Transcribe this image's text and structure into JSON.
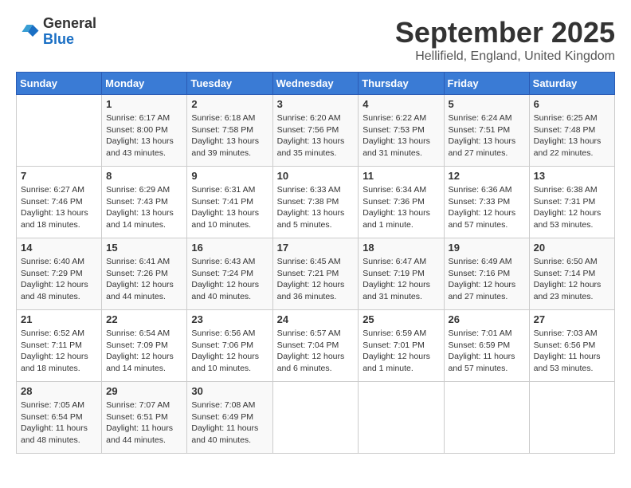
{
  "header": {
    "logo_line1": "General",
    "logo_line2": "Blue",
    "title": "September 2025",
    "subtitle": "Hellifield, England, United Kingdom"
  },
  "weekdays": [
    "Sunday",
    "Monday",
    "Tuesday",
    "Wednesday",
    "Thursday",
    "Friday",
    "Saturday"
  ],
  "weeks": [
    [
      {
        "day": "",
        "info": ""
      },
      {
        "day": "1",
        "info": "Sunrise: 6:17 AM\nSunset: 8:00 PM\nDaylight: 13 hours\nand 43 minutes."
      },
      {
        "day": "2",
        "info": "Sunrise: 6:18 AM\nSunset: 7:58 PM\nDaylight: 13 hours\nand 39 minutes."
      },
      {
        "day": "3",
        "info": "Sunrise: 6:20 AM\nSunset: 7:56 PM\nDaylight: 13 hours\nand 35 minutes."
      },
      {
        "day": "4",
        "info": "Sunrise: 6:22 AM\nSunset: 7:53 PM\nDaylight: 13 hours\nand 31 minutes."
      },
      {
        "day": "5",
        "info": "Sunrise: 6:24 AM\nSunset: 7:51 PM\nDaylight: 13 hours\nand 27 minutes."
      },
      {
        "day": "6",
        "info": "Sunrise: 6:25 AM\nSunset: 7:48 PM\nDaylight: 13 hours\nand 22 minutes."
      }
    ],
    [
      {
        "day": "7",
        "info": "Sunrise: 6:27 AM\nSunset: 7:46 PM\nDaylight: 13 hours\nand 18 minutes."
      },
      {
        "day": "8",
        "info": "Sunrise: 6:29 AM\nSunset: 7:43 PM\nDaylight: 13 hours\nand 14 minutes."
      },
      {
        "day": "9",
        "info": "Sunrise: 6:31 AM\nSunset: 7:41 PM\nDaylight: 13 hours\nand 10 minutes."
      },
      {
        "day": "10",
        "info": "Sunrise: 6:33 AM\nSunset: 7:38 PM\nDaylight: 13 hours\nand 5 minutes."
      },
      {
        "day": "11",
        "info": "Sunrise: 6:34 AM\nSunset: 7:36 PM\nDaylight: 13 hours\nand 1 minute."
      },
      {
        "day": "12",
        "info": "Sunrise: 6:36 AM\nSunset: 7:33 PM\nDaylight: 12 hours\nand 57 minutes."
      },
      {
        "day": "13",
        "info": "Sunrise: 6:38 AM\nSunset: 7:31 PM\nDaylight: 12 hours\nand 53 minutes."
      }
    ],
    [
      {
        "day": "14",
        "info": "Sunrise: 6:40 AM\nSunset: 7:29 PM\nDaylight: 12 hours\nand 48 minutes."
      },
      {
        "day": "15",
        "info": "Sunrise: 6:41 AM\nSunset: 7:26 PM\nDaylight: 12 hours\nand 44 minutes."
      },
      {
        "day": "16",
        "info": "Sunrise: 6:43 AM\nSunset: 7:24 PM\nDaylight: 12 hours\nand 40 minutes."
      },
      {
        "day": "17",
        "info": "Sunrise: 6:45 AM\nSunset: 7:21 PM\nDaylight: 12 hours\nand 36 minutes."
      },
      {
        "day": "18",
        "info": "Sunrise: 6:47 AM\nSunset: 7:19 PM\nDaylight: 12 hours\nand 31 minutes."
      },
      {
        "day": "19",
        "info": "Sunrise: 6:49 AM\nSunset: 7:16 PM\nDaylight: 12 hours\nand 27 minutes."
      },
      {
        "day": "20",
        "info": "Sunrise: 6:50 AM\nSunset: 7:14 PM\nDaylight: 12 hours\nand 23 minutes."
      }
    ],
    [
      {
        "day": "21",
        "info": "Sunrise: 6:52 AM\nSunset: 7:11 PM\nDaylight: 12 hours\nand 18 minutes."
      },
      {
        "day": "22",
        "info": "Sunrise: 6:54 AM\nSunset: 7:09 PM\nDaylight: 12 hours\nand 14 minutes."
      },
      {
        "day": "23",
        "info": "Sunrise: 6:56 AM\nSunset: 7:06 PM\nDaylight: 12 hours\nand 10 minutes."
      },
      {
        "day": "24",
        "info": "Sunrise: 6:57 AM\nSunset: 7:04 PM\nDaylight: 12 hours\nand 6 minutes."
      },
      {
        "day": "25",
        "info": "Sunrise: 6:59 AM\nSunset: 7:01 PM\nDaylight: 12 hours\nand 1 minute."
      },
      {
        "day": "26",
        "info": "Sunrise: 7:01 AM\nSunset: 6:59 PM\nDaylight: 11 hours\nand 57 minutes."
      },
      {
        "day": "27",
        "info": "Sunrise: 7:03 AM\nSunset: 6:56 PM\nDaylight: 11 hours\nand 53 minutes."
      }
    ],
    [
      {
        "day": "28",
        "info": "Sunrise: 7:05 AM\nSunset: 6:54 PM\nDaylight: 11 hours\nand 48 minutes."
      },
      {
        "day": "29",
        "info": "Sunrise: 7:07 AM\nSunset: 6:51 PM\nDaylight: 11 hours\nand 44 minutes."
      },
      {
        "day": "30",
        "info": "Sunrise: 7:08 AM\nSunset: 6:49 PM\nDaylight: 11 hours\nand 40 minutes."
      },
      {
        "day": "",
        "info": ""
      },
      {
        "day": "",
        "info": ""
      },
      {
        "day": "",
        "info": ""
      },
      {
        "day": "",
        "info": ""
      }
    ]
  ]
}
